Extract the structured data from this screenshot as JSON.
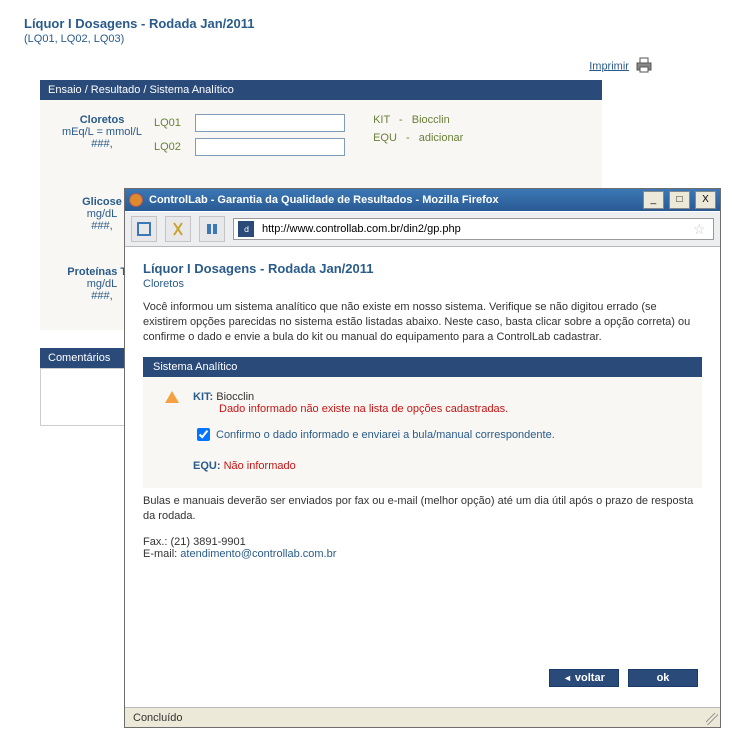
{
  "header": {
    "title": "Líquor I Dosagens - Rodada Jan/2011",
    "codes": "(LQ01, LQ02, LQ03)",
    "print_label": "Imprimir"
  },
  "panel": {
    "header": "Ensaio / Resultado / Sistema Analítico"
  },
  "assays": [
    {
      "name": "Cloretos",
      "unit": "mEq/L = mmol/L",
      "hash": "###,",
      "lq1_label": "LQ01",
      "lq2_label": "LQ02",
      "kit_lbl": "KIT",
      "kit_val": "Biocclin",
      "equ_lbl": "EQU",
      "equ_val": "adicionar"
    },
    {
      "name": "Glicose",
      "unit": "mg/dL",
      "hash": "###,"
    },
    {
      "name": "Proteínas Tot",
      "unit": "mg/dL",
      "hash": "###,"
    }
  ],
  "comments": {
    "header": "Comentários"
  },
  "ff": {
    "title": "ControlLab - Garantia da Qualidade de Resultados - Mozilla Firefox",
    "url": "http://www.controllab.com.br/din2/gp.php",
    "status": "Concluído"
  },
  "modal": {
    "title": "Líquor I Dosagens - Rodada Jan/2011",
    "subtitle": "Cloretos",
    "para": "Você informou um sistema analítico que não existe em nosso sistema. Verifique se não digitou errado (se existirem opções parecidas no sistema estão listadas abaixo. Neste caso, basta clicar sobre a opção correta) ou confirme o dado e envie a bula do kit ou manual do equipamento para a ControlLab cadastrar.",
    "sa_header": "Sistema Analítico",
    "kit_lbl": "KIT:",
    "kit_val": "Biocclin",
    "kit_err": "Dado informado não existe na lista de opções cadastradas.",
    "confirm_label": "Confirmo o dado informado e enviarei a bula/manual correspondente.",
    "equ_lbl": "EQU:",
    "equ_val": "Não informado",
    "bulas": "Bulas e manuais deverão ser enviados por fax ou e-mail (melhor opção) até um dia útil após o prazo de resposta da rodada.",
    "fax_lbl": "Fax.:",
    "fax_val": "(21) 3891-9901",
    "email_lbl": "E-mail:",
    "email_val": "atendimento@controllab.com.br",
    "btn_back": "voltar",
    "btn_ok": "ok"
  }
}
